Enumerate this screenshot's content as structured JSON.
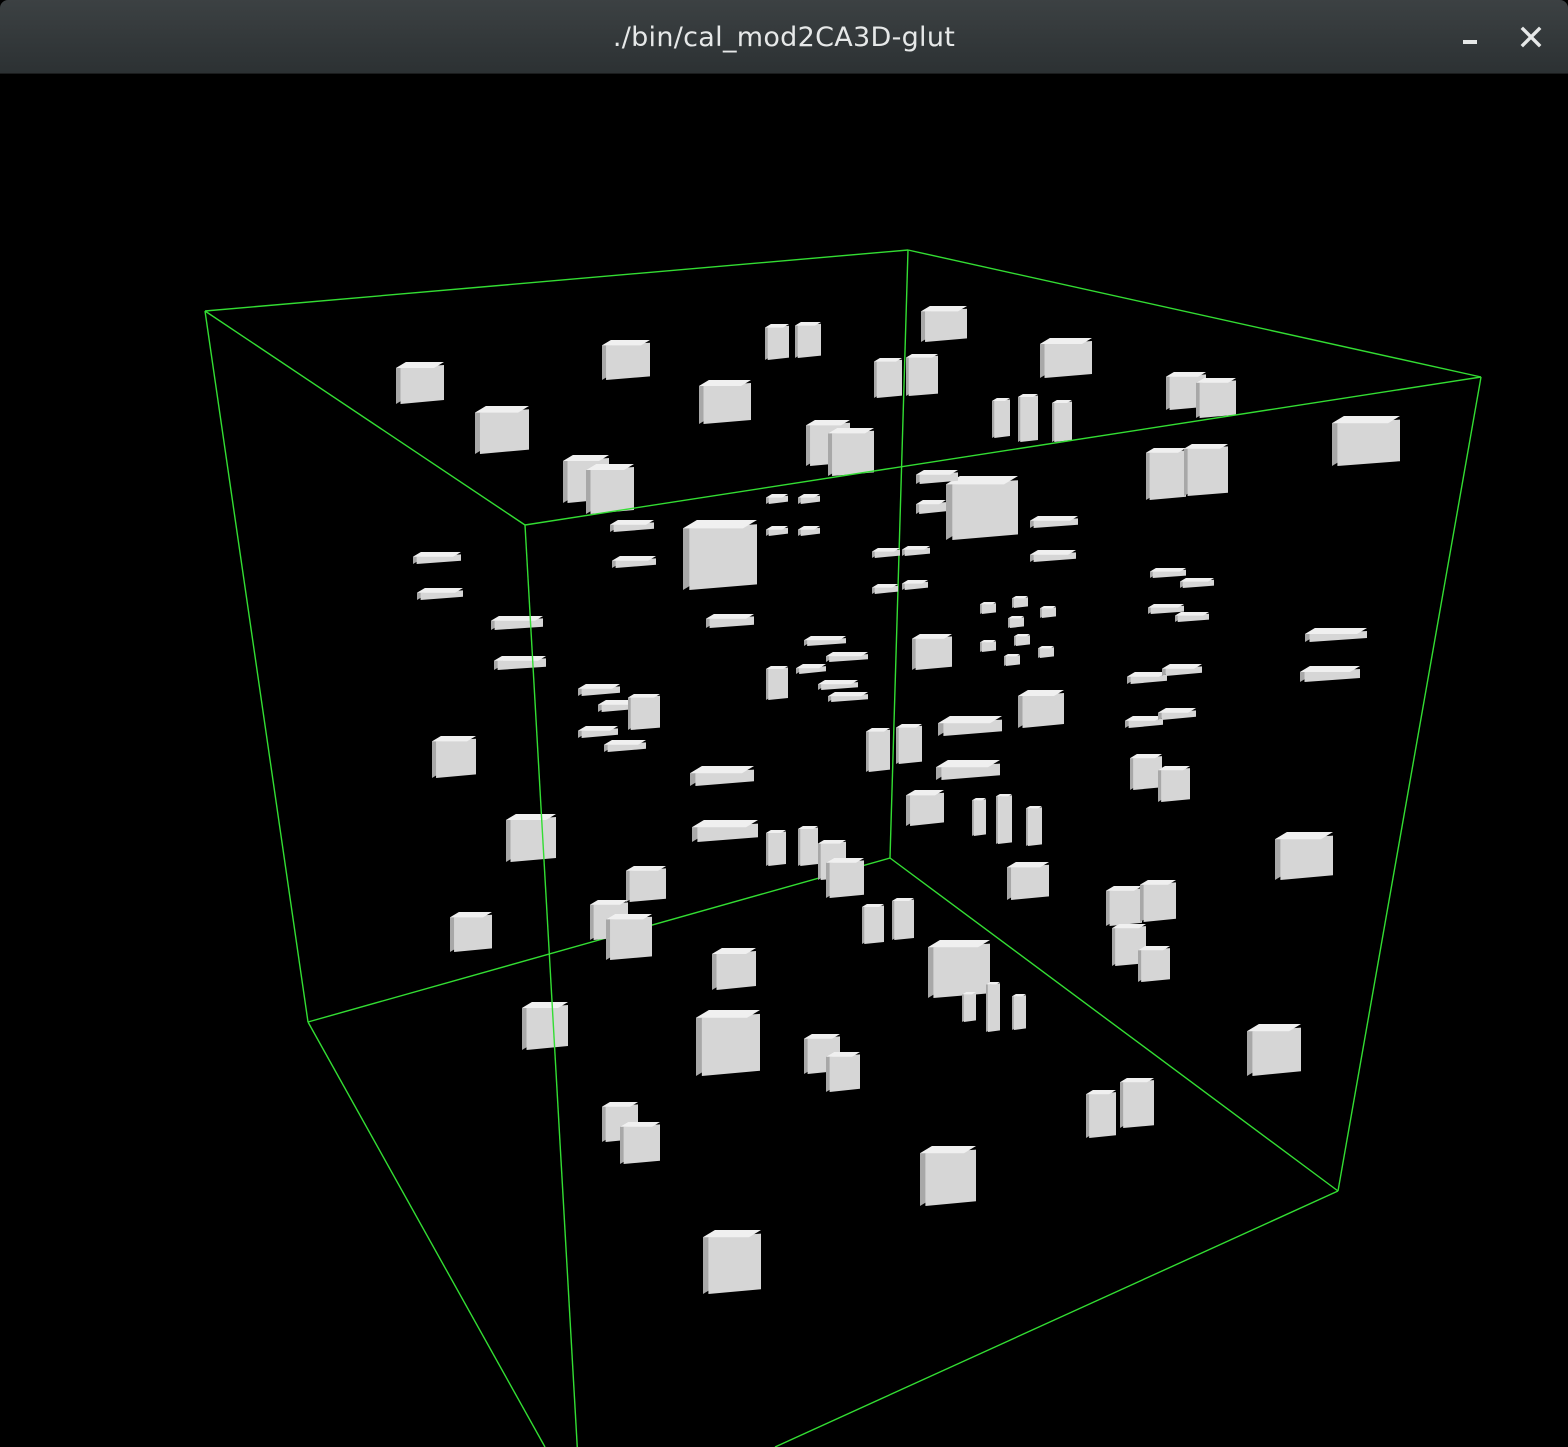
{
  "window": {
    "title": "./bin/cal_mod2CA3D-glut"
  },
  "icons": {
    "minimize": "minimize-icon",
    "close": "close-icon"
  },
  "colors": {
    "background": "#000000",
    "bounding_box": "#33dd33",
    "cell_top": "#f0f0f0",
    "cell_front": "#d6d6d6",
    "cell_side": "#a8a8a8",
    "titlebar": "#35393b",
    "title_text": "#e6e8e8"
  }
}
